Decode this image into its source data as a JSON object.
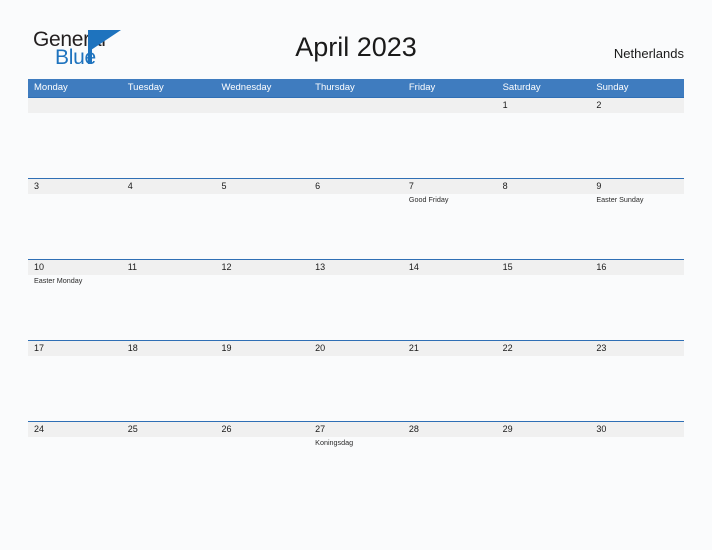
{
  "brand": {
    "word_one": "General",
    "word_two": "Blue",
    "accent_color": "#1e73be",
    "dark_color": "#231f20"
  },
  "header": {
    "title": "April 2023",
    "country": "Netherlands"
  },
  "calendar": {
    "header_bg": "#3f7cbf",
    "band_bg": "#f0f0f0",
    "rule_color": "#2f6fb5",
    "weekdays": [
      "Monday",
      "Tuesday",
      "Wednesday",
      "Thursday",
      "Friday",
      "Saturday",
      "Sunday"
    ],
    "weeks": [
      [
        {
          "day": "",
          "event": ""
        },
        {
          "day": "",
          "event": ""
        },
        {
          "day": "",
          "event": ""
        },
        {
          "day": "",
          "event": ""
        },
        {
          "day": "",
          "event": ""
        },
        {
          "day": "1",
          "event": ""
        },
        {
          "day": "2",
          "event": ""
        }
      ],
      [
        {
          "day": "3",
          "event": ""
        },
        {
          "day": "4",
          "event": ""
        },
        {
          "day": "5",
          "event": ""
        },
        {
          "day": "6",
          "event": ""
        },
        {
          "day": "7",
          "event": "Good Friday"
        },
        {
          "day": "8",
          "event": ""
        },
        {
          "day": "9",
          "event": "Easter Sunday"
        }
      ],
      [
        {
          "day": "10",
          "event": "Easter Monday"
        },
        {
          "day": "11",
          "event": ""
        },
        {
          "day": "12",
          "event": ""
        },
        {
          "day": "13",
          "event": ""
        },
        {
          "day": "14",
          "event": ""
        },
        {
          "day": "15",
          "event": ""
        },
        {
          "day": "16",
          "event": ""
        }
      ],
      [
        {
          "day": "17",
          "event": ""
        },
        {
          "day": "18",
          "event": ""
        },
        {
          "day": "19",
          "event": ""
        },
        {
          "day": "20",
          "event": ""
        },
        {
          "day": "21",
          "event": ""
        },
        {
          "day": "22",
          "event": ""
        },
        {
          "day": "23",
          "event": ""
        }
      ],
      [
        {
          "day": "24",
          "event": ""
        },
        {
          "day": "25",
          "event": ""
        },
        {
          "day": "26",
          "event": ""
        },
        {
          "day": "27",
          "event": "Koningsdag"
        },
        {
          "day": "28",
          "event": ""
        },
        {
          "day": "29",
          "event": ""
        },
        {
          "day": "30",
          "event": ""
        }
      ]
    ]
  }
}
